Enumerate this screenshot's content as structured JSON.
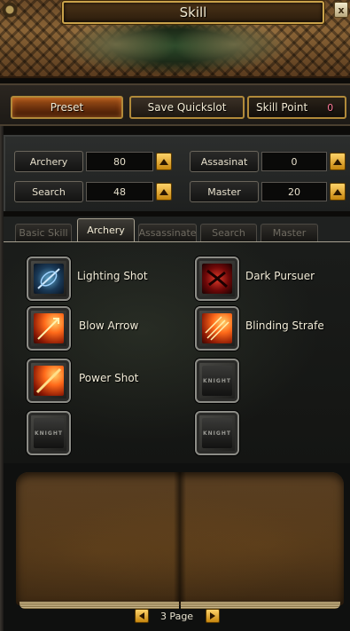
{
  "window": {
    "title": "Skill",
    "close_glyph": "x"
  },
  "toolbar": {
    "preset_label": "Preset",
    "save_quickslot_label": "Save Quickslot",
    "skill_point_label": "Skill Point",
    "skill_point_value": "0"
  },
  "stats": [
    {
      "label": "Archery",
      "value": "80"
    },
    {
      "label": "Assasinat",
      "value": "0"
    },
    {
      "label": "Search",
      "value": "48"
    },
    {
      "label": "Master",
      "value": "20"
    }
  ],
  "tabs": [
    {
      "label": "Basic Skill",
      "active": false
    },
    {
      "label": "Archery",
      "active": true
    },
    {
      "label": "Assassinate",
      "active": false
    },
    {
      "label": "Search",
      "active": false
    },
    {
      "label": "Master",
      "active": false
    }
  ],
  "skills": [
    {
      "name": "Lighting Shot",
      "icon": "lighting-shot-icon"
    },
    {
      "name": "Dark Pursuer",
      "icon": "dark-pursuer-icon"
    },
    {
      "name": "Blow Arrow",
      "icon": "blow-arrow-icon"
    },
    {
      "name": "Blinding Strafe",
      "icon": "blinding-strafe-icon"
    },
    {
      "name": "Power Shot",
      "icon": "power-shot-icon"
    },
    {
      "name": "",
      "icon": "empty-skill-slot-icon"
    },
    {
      "name": "",
      "icon": "empty-skill-slot-icon"
    },
    {
      "name": "",
      "icon": "empty-skill-slot-icon"
    }
  ],
  "empty_slot_text": "KNIGHT",
  "pager": {
    "label": "3 Page"
  },
  "colors": {
    "accent_gold": "#c9a24a",
    "skill_point_pink": "#ff7a9a",
    "preset_orange": "#a8561a"
  }
}
